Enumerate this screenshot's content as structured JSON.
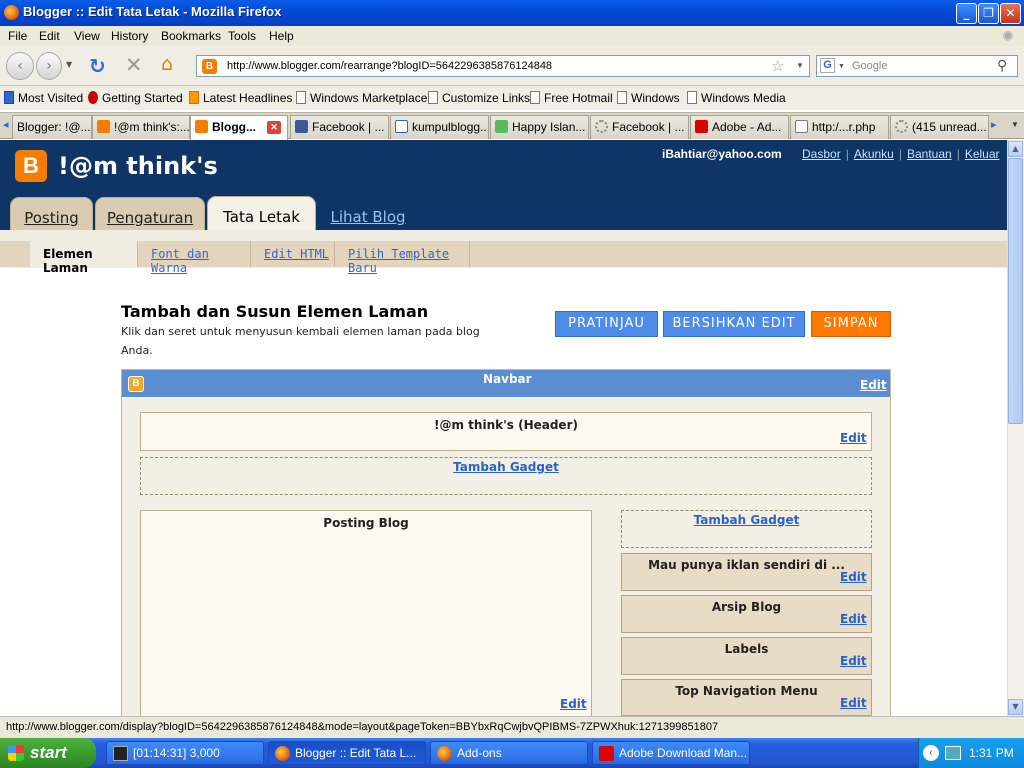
{
  "window": {
    "title": "Blogger :: Edit Tata Letak - Mozilla Firefox"
  },
  "menu": [
    "File",
    "Edit",
    "View",
    "History",
    "Bookmarks",
    "Tools",
    "Help"
  ],
  "url": "http://www.blogger.com/rearrange?blogID=5642296385876124848",
  "search_placeholder": "Google",
  "bookmarks": [
    "Most Visited",
    "Getting Started",
    "Latest Headlines",
    "Windows Marketplace",
    "Customize Links",
    "Free Hotmail",
    "Windows",
    "Windows Media"
  ],
  "tabs": [
    "Blogger: !@...",
    "!@m think's:...",
    "Blogg...",
    "Facebook | ...",
    "kumpulblogg...",
    "Happy Islan...",
    "Facebook | ...",
    "Adobe - Ad...",
    "http:/...r.php",
    "(415 unread..."
  ],
  "blogger": {
    "blog_title": "!@m think's",
    "user_email": "iBahtiar@yahoo.com",
    "top_links": [
      "Dasbor",
      "Akunku",
      "Bantuan",
      "Keluar"
    ],
    "main_tabs": [
      "Posting",
      "Pengaturan",
      "Tata Letak",
      "Lihat Blog"
    ],
    "sub_tabs": [
      "Elemen Laman",
      "Font dan Warna",
      "Edit HTML",
      "Pilih Template Baru"
    ]
  },
  "page": {
    "heading": "Tambah dan Susun Elemen Laman",
    "description": "Klik dan seret untuk menyusun kembali elemen laman pada blog Anda.",
    "buttons": {
      "preview": "PRATINJAU",
      "clear": "BERSIHKAN EDIT",
      "save": "SIMPAN"
    },
    "navbar_label": "Navbar",
    "header_label": "!@m think's (Header)",
    "add_gadget": "Tambah Gadget",
    "edit": "Edit",
    "main_column": "Posting Blog",
    "sidebar": [
      "Mau punya iklan sendiri di ...",
      "Arsip Blog",
      "Labels",
      "Top Navigation Menu"
    ]
  },
  "status_text": "http://www.blogger.com/display?blogID=5642296385876124848&mode=layout&pageToken=BBYbxRqCwjbvQPIBMS-7ZPWXhuk:1271399851807",
  "taskbar": {
    "start": "start",
    "items": [
      "[01:14:31] 3,000",
      "Blogger :: Edit Tata L...",
      "Add-ons",
      "Adobe Download Man..."
    ],
    "clock": "1:31 PM"
  }
}
